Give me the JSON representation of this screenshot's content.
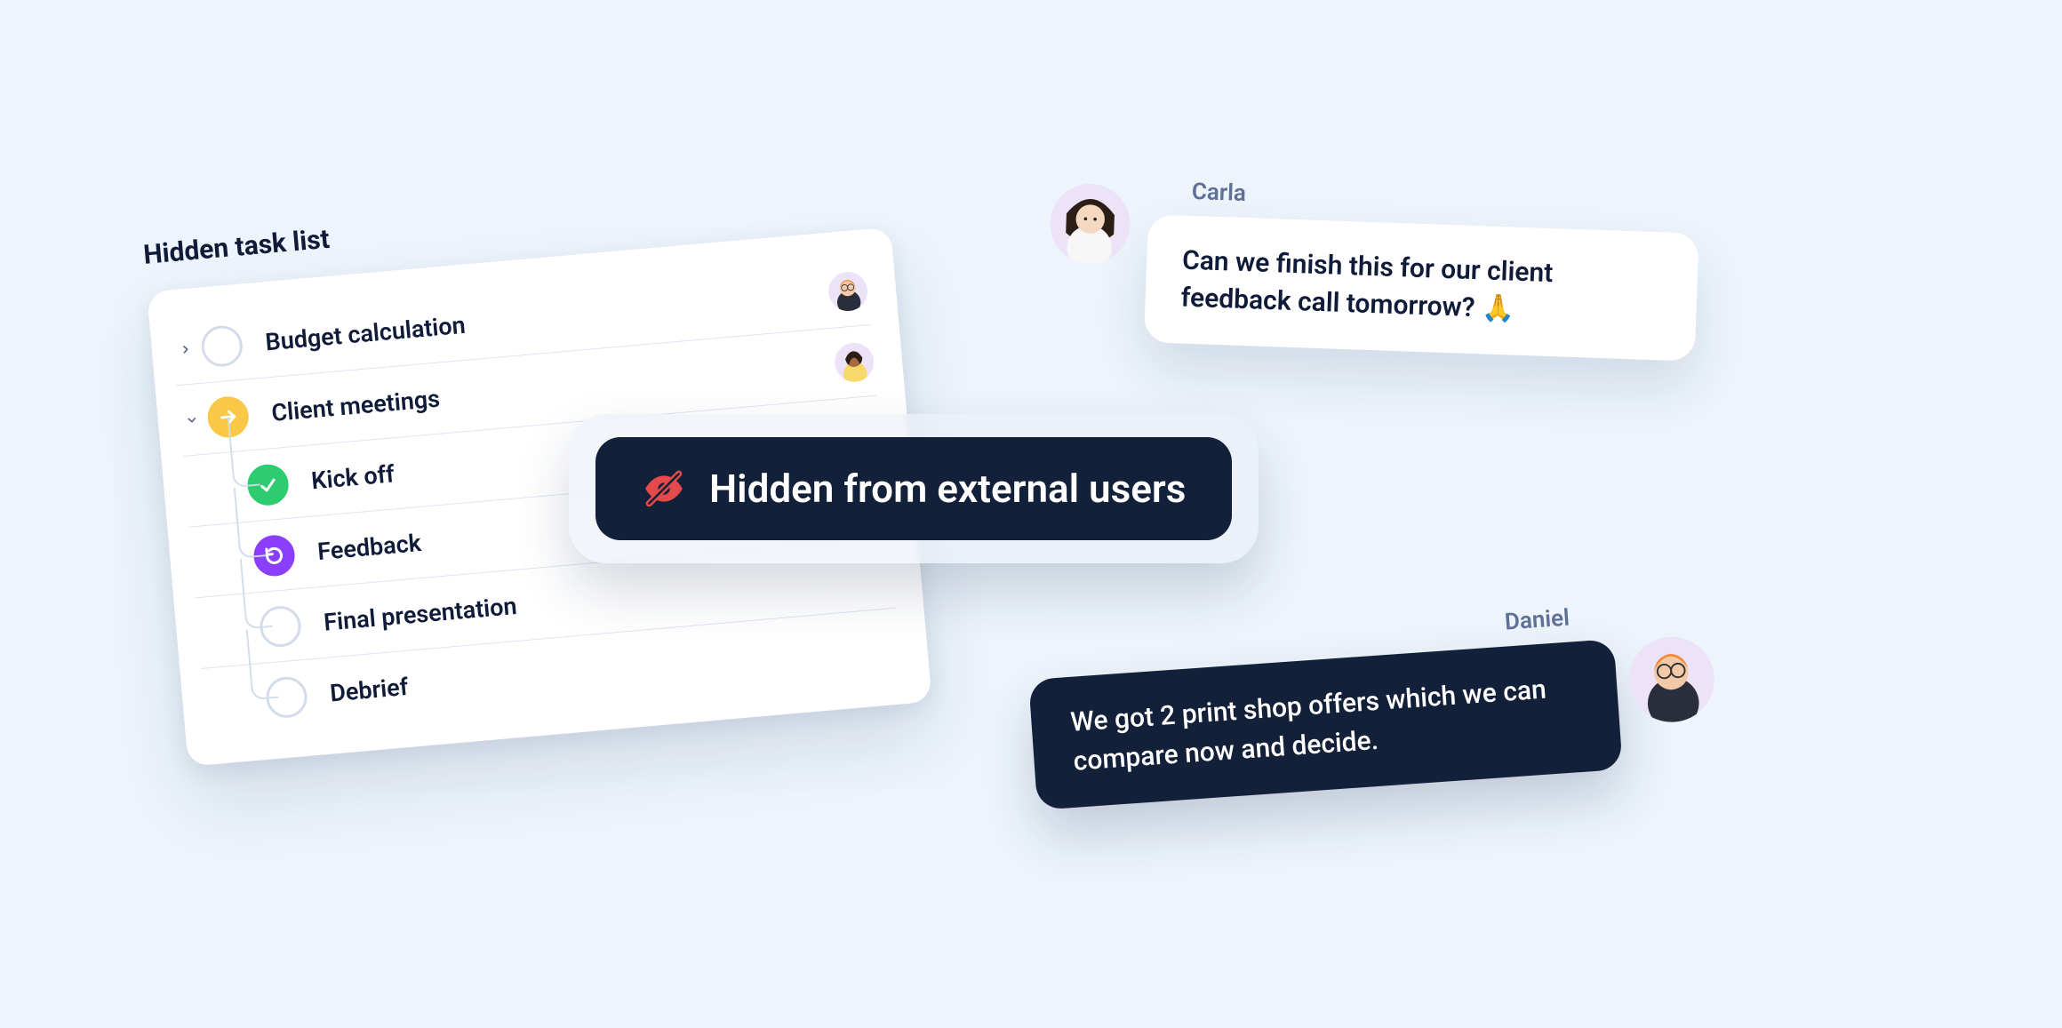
{
  "tasklist": {
    "title": "Hidden task list",
    "rows": [
      {
        "label": "Budget calculation"
      },
      {
        "label": "Client meetings"
      },
      {
        "label": "Kick off"
      },
      {
        "label": "Feedback"
      },
      {
        "label": "Final presentation"
      },
      {
        "label": "Debrief"
      }
    ]
  },
  "banner": {
    "text": "Hidden from external users"
  },
  "chat": {
    "carla": {
      "name": "Carla",
      "text": "Can we finish this for our client feedback call tomorrow? 🙏"
    },
    "daniel": {
      "name": "Daniel",
      "text": "We got 2 print shop offers which we can compare now and decide."
    }
  }
}
